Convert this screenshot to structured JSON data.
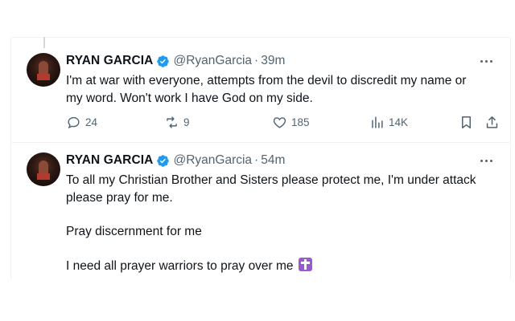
{
  "tweets": [
    {
      "name": "RYAN GARCIA",
      "handle": "@RyanGarcia",
      "dot": "·",
      "time": "39m",
      "lines": [
        "I'm at war with everyone, attempts from the devil to discredit my name or",
        "my word. Won't work I have God on my side."
      ],
      "replies": "24",
      "reposts": "9",
      "likes": "185",
      "views": "14K"
    },
    {
      "name": "RYAN GARCIA",
      "handle": "@RyanGarcia",
      "dot": "·",
      "time": "54m",
      "lines": [
        "To all my Christian Brother and Sisters please protect me, I'm under attack",
        "please pray for me.",
        "Pray discernment for me",
        "I need all prayer warriors to pray over me"
      ]
    }
  ],
  "icons": {
    "verified": "verified-badge-icon",
    "more": "more-options-icon",
    "reply": "reply-icon",
    "repost": "repost-icon",
    "like": "like-icon",
    "views": "views-icon",
    "bookmark": "bookmark-icon",
    "share": "share-icon",
    "emoji": "latin-cross-emoji"
  },
  "colors": {
    "text": "#0f1419",
    "secondary": "#536471",
    "verified": "#1d9bf0",
    "border": "#eff3f4"
  }
}
